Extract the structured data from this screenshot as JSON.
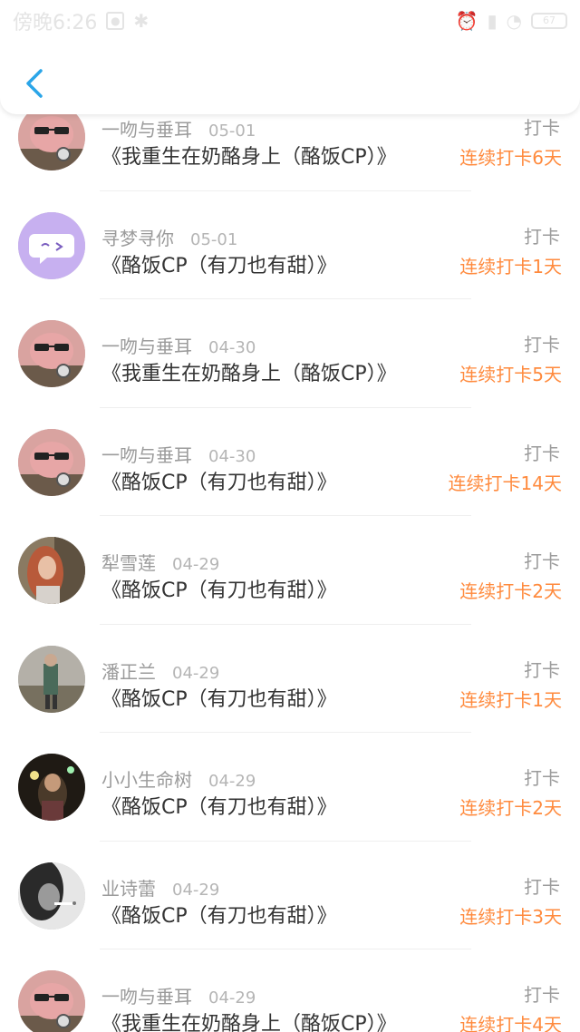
{
  "status_bar": {
    "time": "傍晚6:26",
    "battery": "67"
  },
  "header": {
    "back_icon": "chevron-left-icon",
    "accent_color": "#2aa5e8"
  },
  "streak_color": "#ff8a3d",
  "checkins": [
    {
      "user": "一吻与垂耳",
      "date": "05-01",
      "title": "《我重生在奶酪身上（酪饭CP）》",
      "action": "打卡",
      "streak": "连续打卡6天",
      "avatar": "pig-avatar"
    },
    {
      "user": "寻梦寻你",
      "date": "05-01",
      "title": "《酪饭CP（有刀也有甜）》",
      "action": "打卡",
      "streak": "连续打卡1天",
      "avatar": "chat-bubble-avatar"
    },
    {
      "user": "一吻与垂耳",
      "date": "04-30",
      "title": "《我重生在奶酪身上（酪饭CP）》",
      "action": "打卡",
      "streak": "连续打卡5天",
      "avatar": "pig-avatar"
    },
    {
      "user": "一吻与垂耳",
      "date": "04-30",
      "title": "《酪饭CP（有刀也有甜）》",
      "action": "打卡",
      "streak": "连续打卡14天",
      "avatar": "pig-avatar"
    },
    {
      "user": "犁雪莲",
      "date": "04-29",
      "title": "《酪饭CP（有刀也有甜）》",
      "action": "打卡",
      "streak": "连续打卡2天",
      "avatar": "photo-avatar-woman"
    },
    {
      "user": "潘正兰",
      "date": "04-29",
      "title": "《酪饭CP（有刀也有甜）》",
      "action": "打卡",
      "streak": "连续打卡1天",
      "avatar": "photo-avatar-wall"
    },
    {
      "user": "小小生命树",
      "date": "04-29",
      "title": "《酪饭CP（有刀也有甜）》",
      "action": "打卡",
      "streak": "连续打卡2天",
      "avatar": "photo-avatar-night"
    },
    {
      "user": "业诗蕾",
      "date": "04-29",
      "title": "《酪饭CP（有刀也有甜）》",
      "action": "打卡",
      "streak": "连续打卡3天",
      "avatar": "photo-avatar-bw"
    },
    {
      "user": "一吻与垂耳",
      "date": "04-29",
      "title": "《我重生在奶酪身上（酪饭CP）》",
      "action": "打卡",
      "streak": "连续打卡4天",
      "avatar": "pig-avatar"
    }
  ]
}
